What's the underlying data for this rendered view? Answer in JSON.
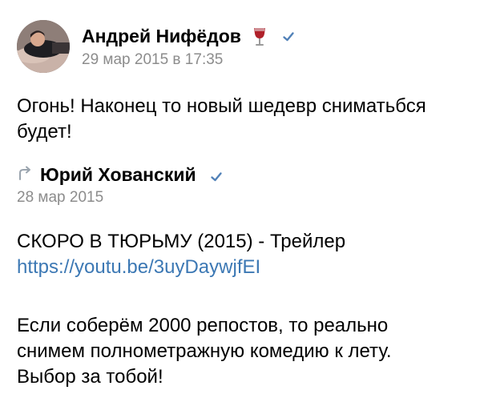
{
  "post": {
    "author": "Андрей Нифёдов",
    "date": "29 мар 2015 в 17:35",
    "text": "Огонь! Наконец то новый шедевр сниматьбся будет!"
  },
  "repost": {
    "author": "Юрий Хованский",
    "date": "28 мар 2015",
    "title": "СКОРО В ТЮРЬМУ (2015) - Трейлер",
    "link": "https://youtu.be/3uyDaywjfEI",
    "body_lines": [
      "Если соберём 2000 репостов, то реально",
      "снимем полнометражную комедию к лету.",
      "Выбор за тобой!"
    ]
  },
  "icons": {
    "wine": "wine-glass-icon",
    "verified": "verified-check-icon",
    "repost": "repost-arrow-icon"
  },
  "colors": {
    "date": "#8c8c8c",
    "link": "#3c78b4",
    "verified": "#5181b8",
    "wine": "#b0202a"
  }
}
